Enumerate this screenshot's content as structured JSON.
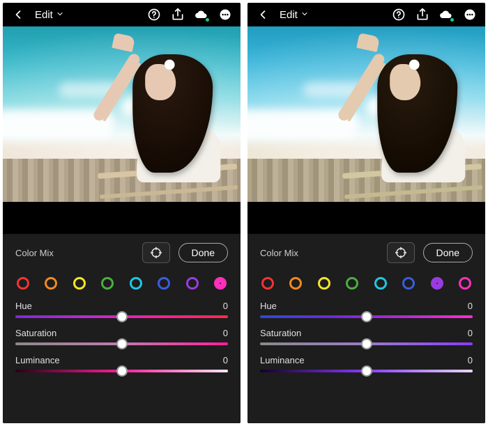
{
  "header": {
    "title_label": "Edit"
  },
  "panel": {
    "title_label": "Color Mix",
    "done_label": "Done"
  },
  "swatches": [
    {
      "name": "red",
      "hex": "#ef3535"
    },
    {
      "name": "orange",
      "hex": "#f28a1e"
    },
    {
      "name": "yellow",
      "hex": "#f7e528"
    },
    {
      "name": "green",
      "hex": "#4caf3f"
    },
    {
      "name": "aqua",
      "hex": "#1fc8e3"
    },
    {
      "name": "blue",
      "hex": "#3a5de0"
    },
    {
      "name": "purple",
      "hex": "#9a3be0"
    },
    {
      "name": "magenta",
      "hex": "#ff2fbd"
    }
  ],
  "sliders": {
    "hue": {
      "label": "Hue",
      "value": 0,
      "pos": 50
    },
    "saturation": {
      "label": "Saturation",
      "value": 0,
      "pos": 50
    },
    "luminance": {
      "label": "Luminance",
      "value": 0,
      "pos": 50
    }
  },
  "screens": [
    {
      "selected_color": "magenta",
      "gradients": {
        "hue": "grad-hue-m",
        "saturation": "grad-sat-m",
        "luminance": "grad-lum-m"
      },
      "photo_variant": "normal"
    },
    {
      "selected_color": "purple",
      "gradients": {
        "hue": "grad-hue-p",
        "saturation": "grad-sat-p",
        "luminance": "grad-lum-p"
      },
      "photo_variant": "teal"
    }
  ]
}
